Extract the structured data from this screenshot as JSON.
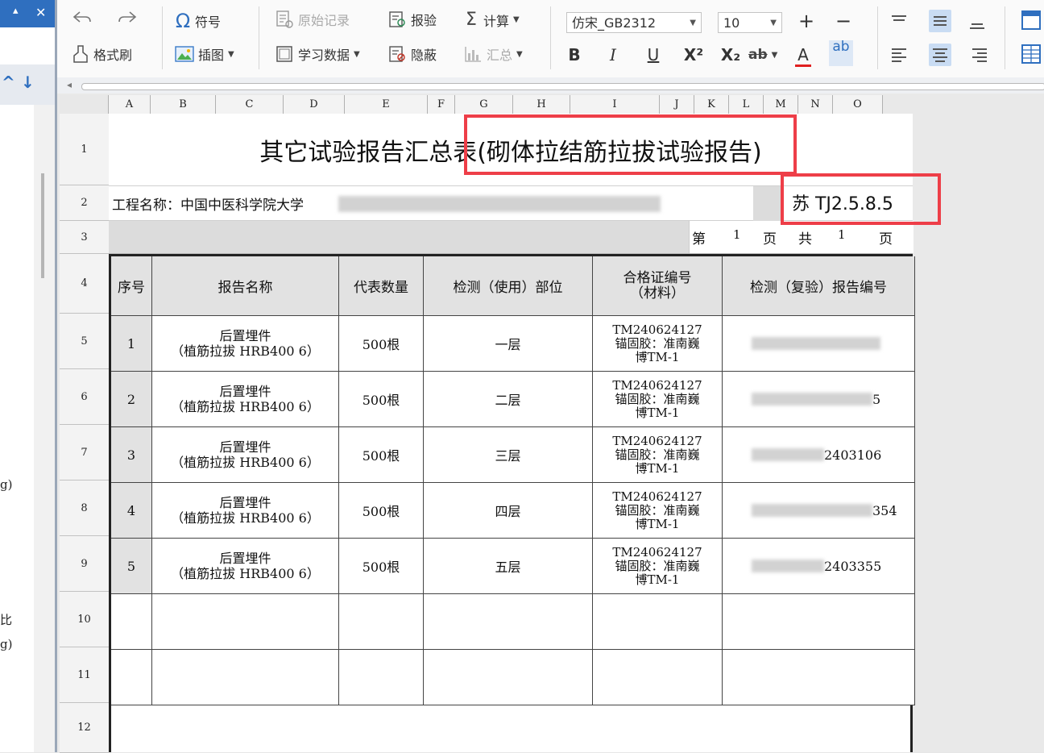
{
  "left_panel": {
    "pin_icon": "pin-icon",
    "close_label": "✕",
    "up_arrow": "^",
    "down_arrow": "↓",
    "fragments": [
      "g)",
      "比",
      "g)"
    ]
  },
  "ribbon": {
    "undo_icon": "undo-icon",
    "redo_icon": "redo-icon",
    "format_painter": "格式刷",
    "symbol": "符号",
    "insert_image": "插图",
    "original_record": "原始记录",
    "learning_data": "学习数据",
    "report_check": "报验",
    "hide": "隐蔽",
    "calculate": "计算",
    "summary": "汇总",
    "font_name": "仿宋_GB2312",
    "font_size": "10",
    "bold": "B",
    "italic": "I",
    "underline": "U",
    "superscript": "X²",
    "subscript": "X₂",
    "strikethrough": "ab",
    "font_color": "A",
    "wrap": "ab",
    "increase_size": "+",
    "decrease_size": "−"
  },
  "columns": [
    "A",
    "B",
    "C",
    "D",
    "E",
    "F",
    "G",
    "H",
    "I",
    "J",
    "K",
    "L",
    "M",
    "N",
    "O"
  ],
  "rows": [
    "1",
    "2",
    "3",
    "4",
    "5",
    "6",
    "7",
    "8",
    "9",
    "10",
    "11",
    "12"
  ],
  "sheet": {
    "title_main": "其它试验报告汇总表",
    "title_highlight": "(砌体拉结筋拉拔试验报告)",
    "project_label": "工程名称：中国中医科学院大学",
    "standard_code": "苏 TJ2.5.8.5",
    "page_label_di": "第",
    "page_current": "1",
    "page_label_ye": "页",
    "page_label_gong": "共",
    "page_total": "1",
    "page_label_ye2": "页",
    "headers": {
      "index": "序号",
      "report_name": "报告名称",
      "quantity": "代表数量",
      "location": "检测（使用）部位",
      "cert_line1": "合格证编号",
      "cert_line2": "（材料）",
      "report_no": "检测（复验）报告编号"
    },
    "records": [
      {
        "index": "1",
        "name1": "后置埋件",
        "name2": "（植筋拉拔 HRB400 6）",
        "qty": "500根",
        "loc": "一层",
        "cert1": "TM240624127",
        "cert2": "锚固胶：准南巍",
        "cert3": "博TM-1",
        "report_tail": ""
      },
      {
        "index": "2",
        "name1": "后置埋件",
        "name2": "（植筋拉拔 HRB400 6）",
        "qty": "500根",
        "loc": "二层",
        "cert1": "TM240624127",
        "cert2": "锚固胶：准南巍",
        "cert3": "博TM-1",
        "report_tail": "5"
      },
      {
        "index": "3",
        "name1": "后置埋件",
        "name2": "（植筋拉拔 HRB400 6）",
        "qty": "500根",
        "loc": "三层",
        "cert1": "TM240624127",
        "cert2": "锚固胶：准南巍",
        "cert3": "博TM-1",
        "report_tail": "2403106"
      },
      {
        "index": "4",
        "name1": "后置埋件",
        "name2": "（植筋拉拔 HRB400 6）",
        "qty": "500根",
        "loc": "四层",
        "cert1": "TM240624127",
        "cert2": "锚固胶：准南巍",
        "cert3": "博TM-1",
        "report_tail": "354"
      },
      {
        "index": "5",
        "name1": "后置埋件",
        "name2": "（植筋拉拔 HRB400 6）",
        "qty": "500根",
        "loc": "五层",
        "cert1": "TM240624127",
        "cert2": "锚固胶：准南巍",
        "cert3": "博TM-1",
        "report_tail": "2403355"
      }
    ]
  },
  "colors": {
    "highlight_box": "#ee3e48",
    "accent_blue": "#2f6fbf"
  }
}
